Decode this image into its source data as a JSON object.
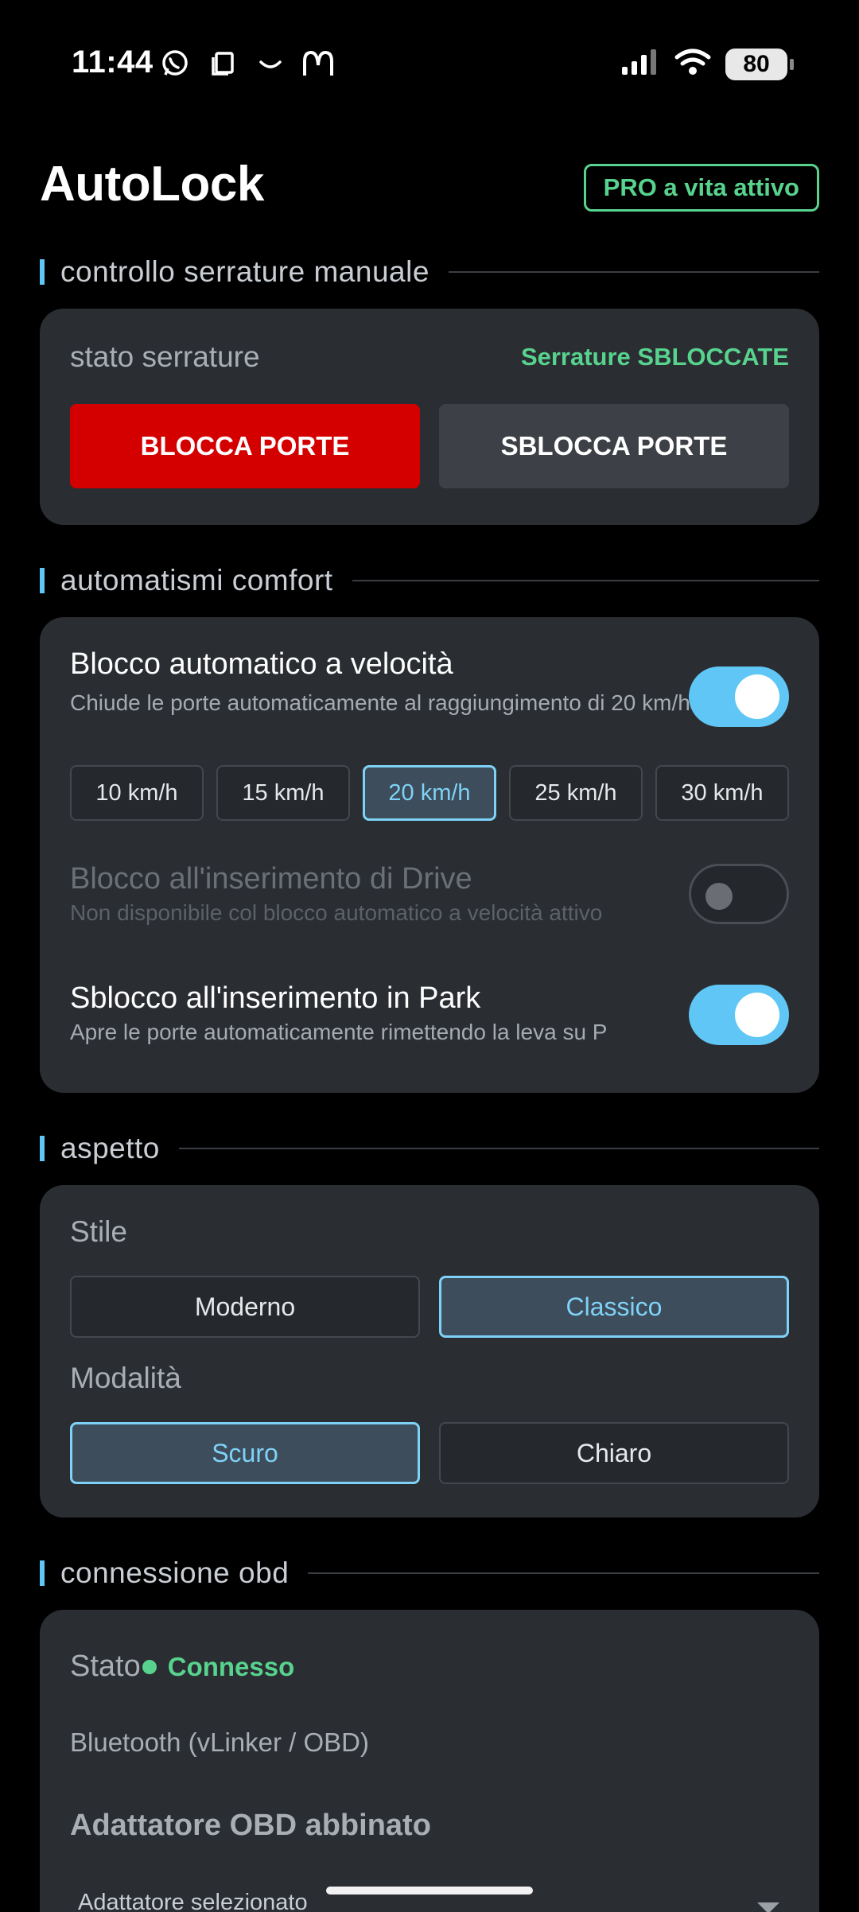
{
  "status_bar": {
    "time": "11:44",
    "battery": "80",
    "left_icons": [
      "whatsapp-icon",
      "clipboard-icon",
      "smile-icon",
      "mcdonalds-icon"
    ],
    "right_icons": [
      "signal-icon",
      "wifi-icon",
      "battery-icon"
    ]
  },
  "header": {
    "title": "AutoLock",
    "pro_badge": "PRO a vita attivo"
  },
  "manual_lock": {
    "section_label": "controllo serrature manuale",
    "status_label": "stato serrature",
    "status_value": "Serrature SBLOCCATE",
    "lock_button": "BLOCCA PORTE",
    "unlock_button": "SBLOCCA PORTE",
    "colors": {
      "lock": "#d40000",
      "status_ok": "#58d38e"
    }
  },
  "comfort": {
    "section_label": "automatismi comfort",
    "speed_lock": {
      "title": "Blocco automatico a velocità",
      "subtitle": "Chiude le porte automaticamente al raggiungimento di 20 km/h",
      "enabled": true,
      "speeds": [
        "10 km/h",
        "15 km/h",
        "20 km/h",
        "25 km/h",
        "30 km/h"
      ],
      "selected_speed": "20 km/h"
    },
    "drive_lock": {
      "title": "Blocco all'inserimento di Drive",
      "subtitle": "Non disponibile col blocco automatico a velocità attivo",
      "enabled": false,
      "available": false
    },
    "park_unlock": {
      "title": "Sblocco all'inserimento in Park",
      "subtitle": "Apre le porte automaticamente rimettendo la leva su P",
      "enabled": true
    },
    "colors": {
      "accent": "#5fc6f5"
    }
  },
  "appearance": {
    "section_label": "aspetto",
    "style_label": "Stile",
    "style_options": [
      "Moderno",
      "Classico"
    ],
    "style_selected": "Classico",
    "mode_label": "Modalità",
    "mode_options": [
      "Scuro",
      "Chiaro"
    ],
    "mode_selected": "Scuro"
  },
  "obd": {
    "section_label": "connessione obd",
    "state_label": "Stato",
    "state_value": "Connesso",
    "connection_type": "Bluetooth (vLinker / OBD)",
    "paired_title": "Adattatore OBD abbinato",
    "selected_label": "Adattatore selezionato"
  }
}
